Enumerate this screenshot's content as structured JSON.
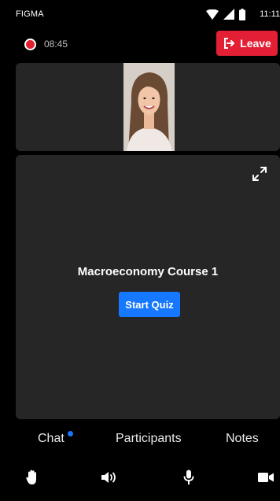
{
  "status_bar": {
    "carrier": "FIGMA",
    "time": "11:11",
    "icons": [
      "wifi-icon",
      "signal-icon",
      "battery-icon"
    ]
  },
  "recording": {
    "time": "08:45",
    "color": "#e0202f"
  },
  "leave_button": {
    "label": "Leave",
    "icon": "exit-icon",
    "color": "#e21f34"
  },
  "video_strip": {
    "participant": "participant-video"
  },
  "stage": {
    "title": "Macroeconomy Course 1",
    "quiz_button_label": "Start Quiz",
    "accent": "#1677ff",
    "icon": "expand-icon"
  },
  "tabs": [
    {
      "label": "Chat",
      "has_badge": true
    },
    {
      "label": "Participants"
    },
    {
      "label": "Notes"
    }
  ],
  "controls": [
    "raise-hand-icon",
    "speaker-icon",
    "microphone-icon",
    "camera-icon"
  ]
}
